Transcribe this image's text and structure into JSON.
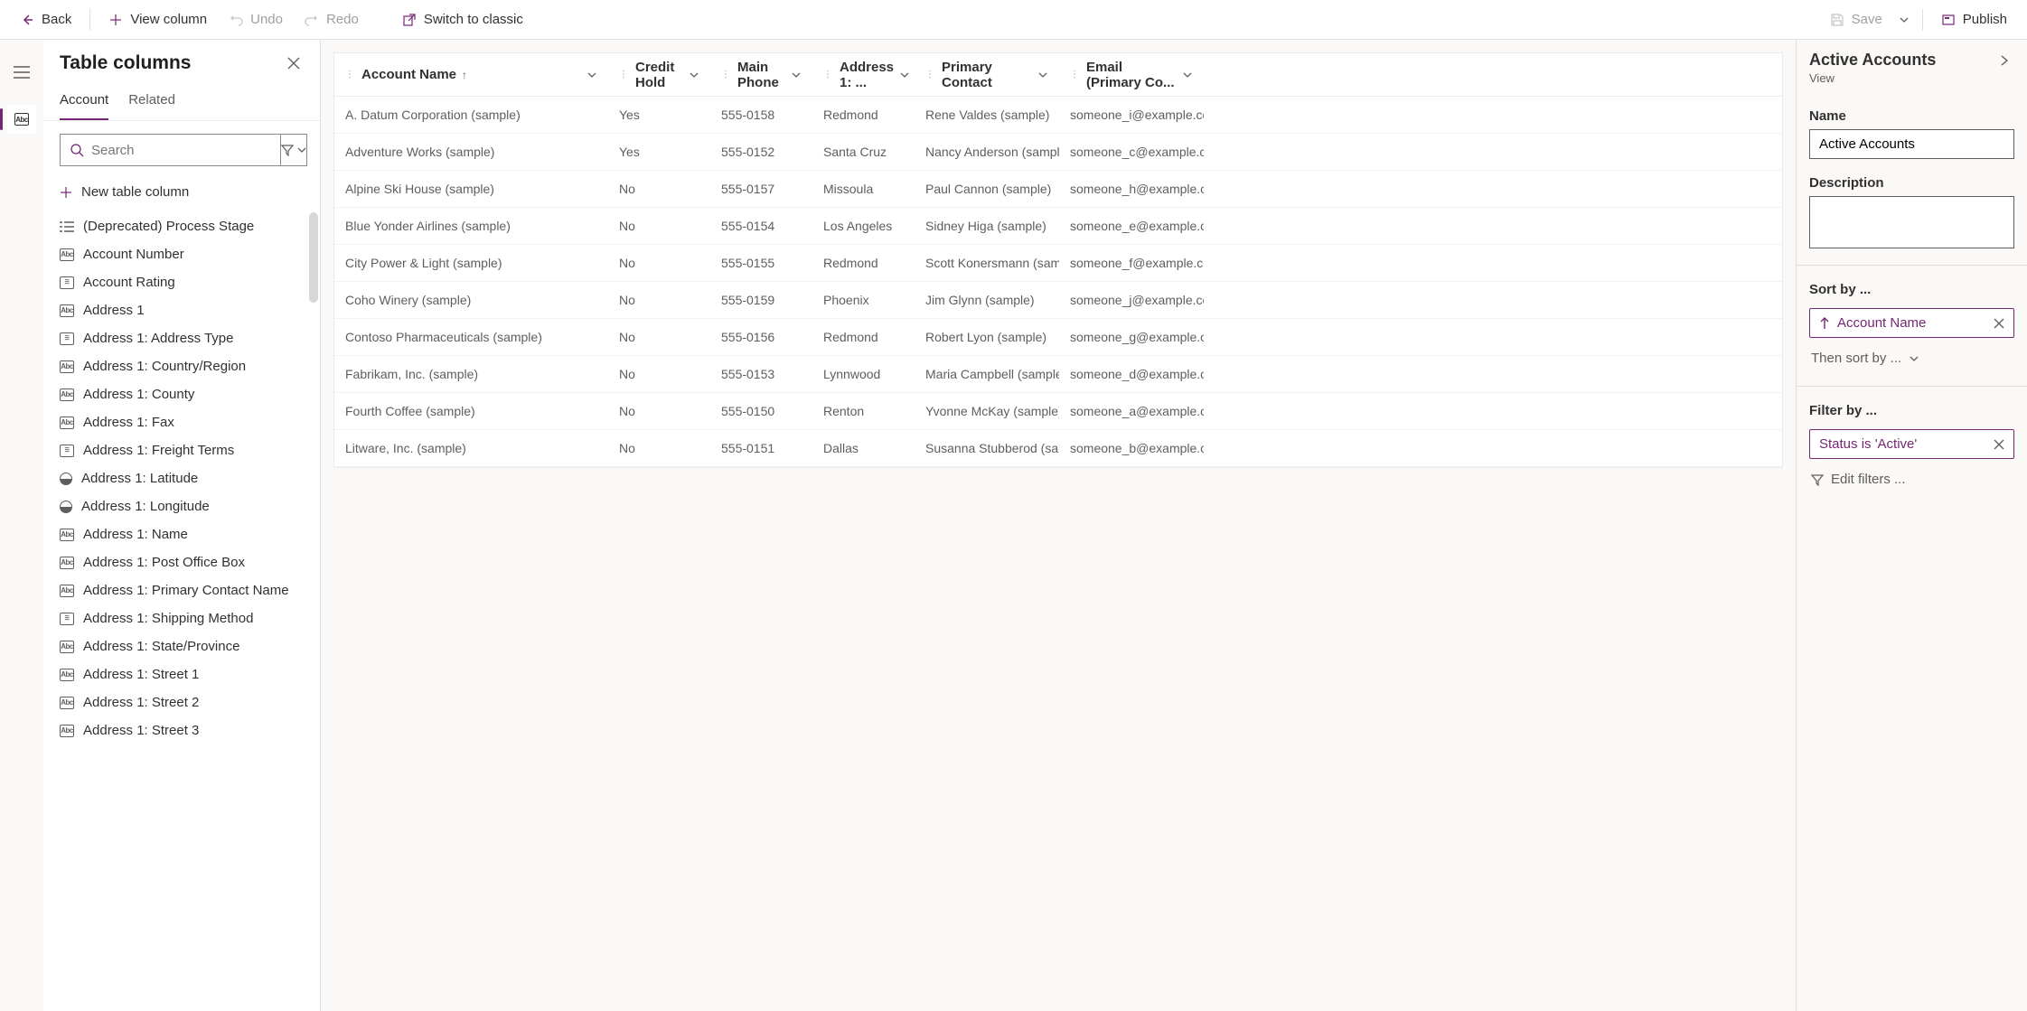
{
  "toolbar": {
    "back": "Back",
    "view_column": "View column",
    "undo": "Undo",
    "redo": "Redo",
    "switch_classic": "Switch to classic",
    "save": "Save",
    "publish": "Publish"
  },
  "left_panel": {
    "title": "Table columns",
    "tabs": {
      "account": "Account",
      "related": "Related"
    },
    "search_placeholder": "Search",
    "new_column": "New table column",
    "columns": [
      {
        "label": "(Deprecated) Process Stage",
        "type": "list"
      },
      {
        "label": "Account Number",
        "type": "abc"
      },
      {
        "label": "Account Rating",
        "type": "opt"
      },
      {
        "label": "Address 1",
        "type": "abc"
      },
      {
        "label": "Address 1: Address Type",
        "type": "opt"
      },
      {
        "label": "Address 1: Country/Region",
        "type": "abc"
      },
      {
        "label": "Address 1: County",
        "type": "abc"
      },
      {
        "label": "Address 1: Fax",
        "type": "abc"
      },
      {
        "label": "Address 1: Freight Terms",
        "type": "opt"
      },
      {
        "label": "Address 1: Latitude",
        "type": "globe"
      },
      {
        "label": "Address 1: Longitude",
        "type": "globe"
      },
      {
        "label": "Address 1: Name",
        "type": "abc"
      },
      {
        "label": "Address 1: Post Office Box",
        "type": "abc"
      },
      {
        "label": "Address 1: Primary Contact Name",
        "type": "abc"
      },
      {
        "label": "Address 1: Shipping Method",
        "type": "opt"
      },
      {
        "label": "Address 1: State/Province",
        "type": "abc"
      },
      {
        "label": "Address 1: Street 1",
        "type": "abc"
      },
      {
        "label": "Address 1: Street 2",
        "type": "abc"
      },
      {
        "label": "Address 1: Street 3",
        "type": "abc"
      }
    ]
  },
  "grid": {
    "headers": {
      "name": "Account Name",
      "credit": "Credit Hold",
      "phone": "Main Phone",
      "city": "Address 1: ...",
      "contact": "Primary Contact",
      "email": "Email (Primary Co..."
    },
    "rows": [
      {
        "name": "A. Datum Corporation (sample)",
        "credit": "Yes",
        "phone": "555-0158",
        "city": "Redmond",
        "contact": "Rene Valdes (sample)",
        "email": "someone_i@example.com"
      },
      {
        "name": "Adventure Works (sample)",
        "credit": "Yes",
        "phone": "555-0152",
        "city": "Santa Cruz",
        "contact": "Nancy Anderson (sample)",
        "email": "someone_c@example.com"
      },
      {
        "name": "Alpine Ski House (sample)",
        "credit": "No",
        "phone": "555-0157",
        "city": "Missoula",
        "contact": "Paul Cannon (sample)",
        "email": "someone_h@example.com"
      },
      {
        "name": "Blue Yonder Airlines (sample)",
        "credit": "No",
        "phone": "555-0154",
        "city": "Los Angeles",
        "contact": "Sidney Higa (sample)",
        "email": "someone_e@example.com"
      },
      {
        "name": "City Power & Light (sample)",
        "credit": "No",
        "phone": "555-0155",
        "city": "Redmond",
        "contact": "Scott Konersmann (sample)",
        "email": "someone_f@example.com"
      },
      {
        "name": "Coho Winery (sample)",
        "credit": "No",
        "phone": "555-0159",
        "city": "Phoenix",
        "contact": "Jim Glynn (sample)",
        "email": "someone_j@example.com"
      },
      {
        "name": "Contoso Pharmaceuticals (sample)",
        "credit": "No",
        "phone": "555-0156",
        "city": "Redmond",
        "contact": "Robert Lyon (sample)",
        "email": "someone_g@example.com"
      },
      {
        "name": "Fabrikam, Inc. (sample)",
        "credit": "No",
        "phone": "555-0153",
        "city": "Lynnwood",
        "contact": "Maria Campbell (sample)",
        "email": "someone_d@example.com"
      },
      {
        "name": "Fourth Coffee (sample)",
        "credit": "No",
        "phone": "555-0150",
        "city": "Renton",
        "contact": "Yvonne McKay (sample)",
        "email": "someone_a@example.com"
      },
      {
        "name": "Litware, Inc. (sample)",
        "credit": "No",
        "phone": "555-0151",
        "city": "Dallas",
        "contact": "Susanna Stubberod (sampl...",
        "email": "someone_b@example.com"
      }
    ]
  },
  "right_panel": {
    "title": "Active Accounts",
    "subtitle": "View",
    "name_label": "Name",
    "name_value": "Active Accounts",
    "description_label": "Description",
    "description_value": "",
    "sort_label": "Sort by ...",
    "sort_chip": "Account Name",
    "then_sort": "Then sort by ...",
    "filter_label": "Filter by ...",
    "filter_chip": "Status is 'Active'",
    "edit_filters": "Edit filters ..."
  }
}
